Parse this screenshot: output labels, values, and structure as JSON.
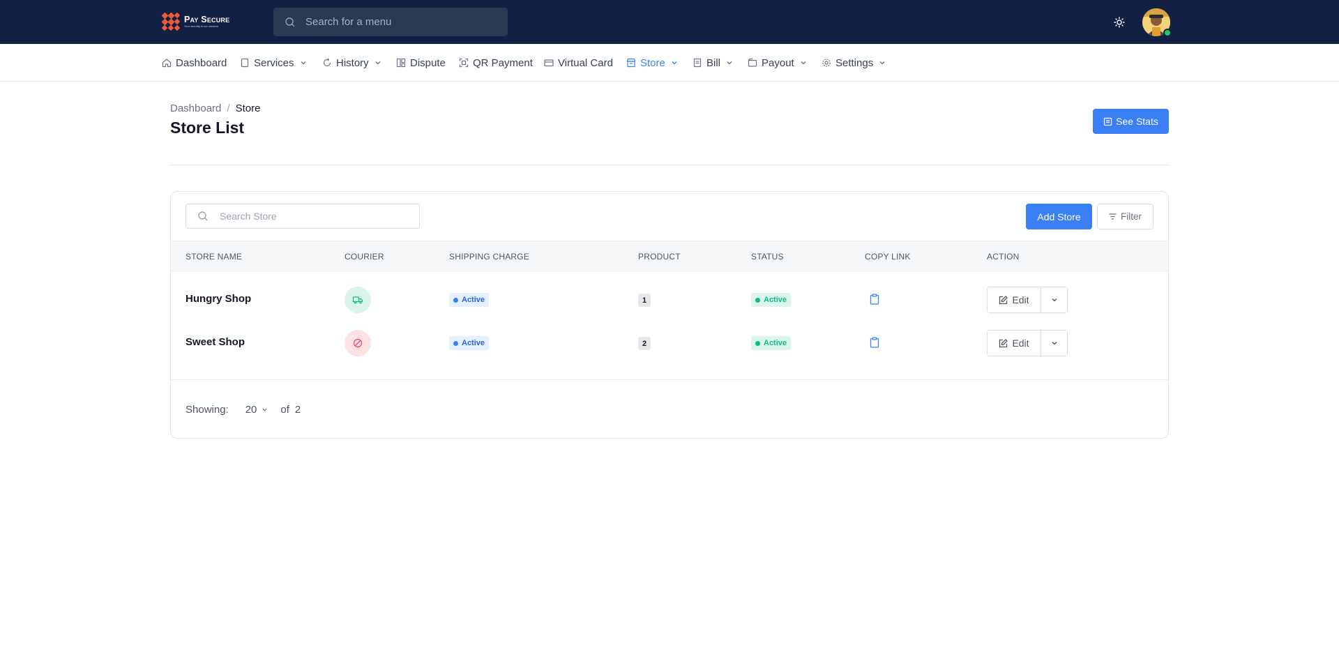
{
  "brand": {
    "name": "Pay Secure",
    "tagline": "Your security is our concern",
    "logo_color": "#f05a37"
  },
  "top_search": {
    "placeholder": "Search for a menu"
  },
  "nav": {
    "items": [
      {
        "label": "Dashboard",
        "icon": "home-icon",
        "dropdown": false
      },
      {
        "label": "Services",
        "icon": "file-icon",
        "dropdown": true
      },
      {
        "label": "History",
        "icon": "refresh-icon",
        "dropdown": true
      },
      {
        "label": "Dispute",
        "icon": "layout-icon",
        "dropdown": false
      },
      {
        "label": "QR Payment",
        "icon": "qr-icon",
        "dropdown": false
      },
      {
        "label": "Virtual Card",
        "icon": "card-icon",
        "dropdown": false
      },
      {
        "label": "Store",
        "icon": "store-icon",
        "dropdown": true,
        "active": true
      },
      {
        "label": "Bill",
        "icon": "bill-icon",
        "dropdown": true
      },
      {
        "label": "Payout",
        "icon": "wallet-icon",
        "dropdown": true
      },
      {
        "label": "Settings",
        "icon": "gear-icon",
        "dropdown": true
      }
    ]
  },
  "breadcrumb": {
    "parent": "Dashboard",
    "separator": "/",
    "current": "Store"
  },
  "page": {
    "title": "Store List",
    "stats_button": "See Stats"
  },
  "toolbar": {
    "search_placeholder": "Search Store",
    "add_label": "Add Store",
    "filter_label": "Filter"
  },
  "table": {
    "headers": {
      "store_name": "STORE NAME",
      "courier": "COURIER",
      "shipping_charge": "SHIPPING CHARGE",
      "product": "PRODUCT",
      "status": "STATUS",
      "copy_link": "COPY LINK",
      "action": "ACTION"
    },
    "rows": [
      {
        "store_name": "Hungry Shop",
        "courier": "truck-icon",
        "shipping_charge": "Active",
        "product": "1",
        "status": "Active",
        "edit": "Edit"
      },
      {
        "store_name": "Sweet Shop",
        "courier": "ban-icon",
        "shipping_charge": "Active",
        "product": "2",
        "status": "Active",
        "edit": "Edit"
      }
    ]
  },
  "pagination": {
    "showing_label": "Showing:",
    "per_page": "20",
    "of_label": "of",
    "total": "2"
  },
  "colors": {
    "topbar": "#132043",
    "accent": "#3b7ff5",
    "active_green": "#10b981",
    "online_status": "#22c55e"
  }
}
